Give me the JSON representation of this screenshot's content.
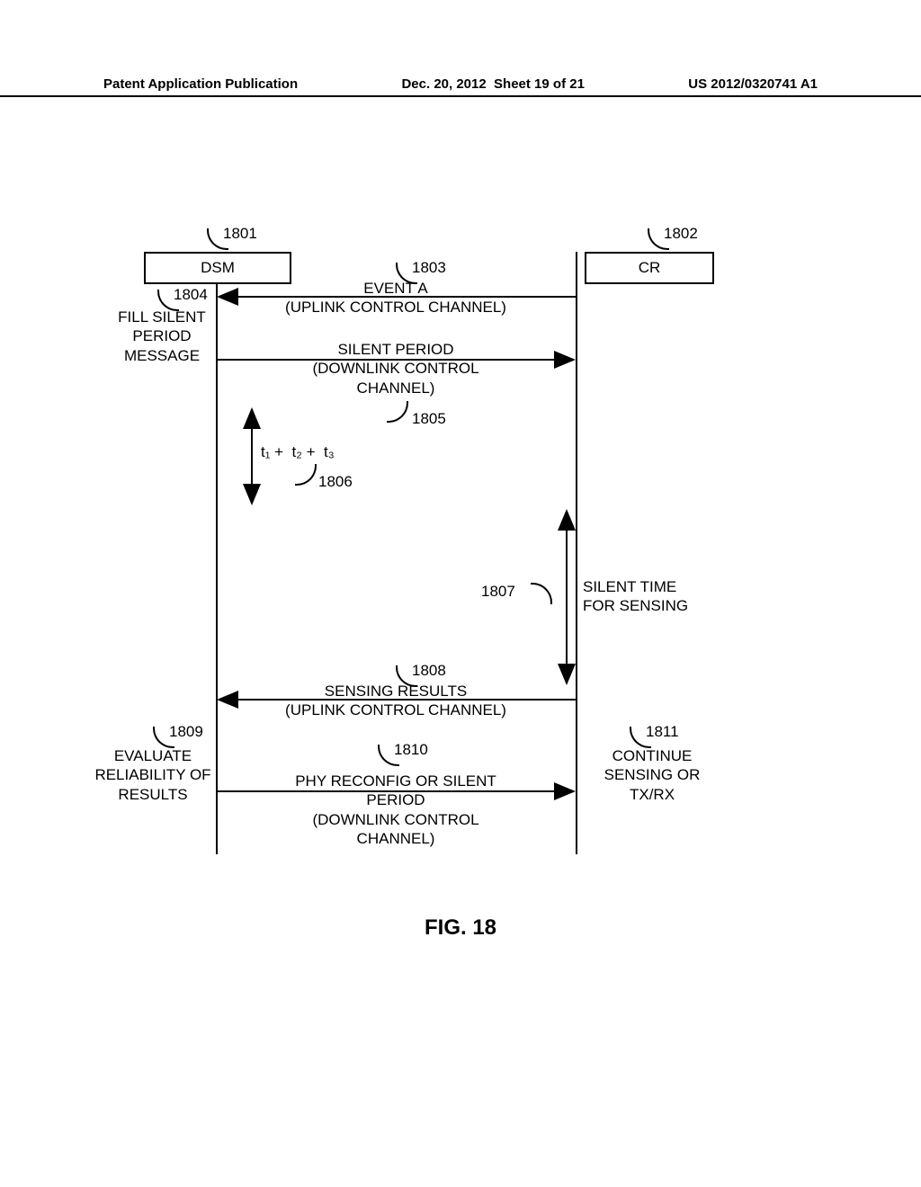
{
  "header": {
    "left": "Patent Application Publication",
    "center": "Dec. 20, 2012  Sheet 19 of 21",
    "right": "US 2012/0320741 A1"
  },
  "boxes": {
    "dsm": "DSM",
    "cr": "CR"
  },
  "refs": {
    "r1801": "1801",
    "r1802": "1802",
    "r1803": "1803",
    "r1804": "1804",
    "r1805": "1805",
    "r1806": "1806",
    "r1807": "1807",
    "r1808": "1808",
    "r1809": "1809",
    "r1810": "1810",
    "r1811": "1811"
  },
  "labels": {
    "event_a": "EVENT A\n(UPLINK CONTROL CHANNEL)",
    "fill_silent": "FILL SILENT\nPERIOD\nMESSAGE",
    "silent_period": "SILENT PERIOD\n(DOWNLINK CONTROL\nCHANNEL)",
    "time_formula": "t₁ +  t₂ +  t₃",
    "silent_time": "SILENT TIME\nFOR SENSING",
    "sensing_results": "SENSING RESULTS\n(UPLINK CONTROL CHANNEL)",
    "evaluate": "EVALUATE\nRELIABILITY OF\nRESULTS",
    "phy_reconfig": "PHY RECONFIG OR SILENT\nPERIOD\n(DOWNLINK CONTROL\nCHANNEL)",
    "continue": "CONTINUE\nSENSING OR\nTX/RX"
  },
  "figure": "FIG. 18"
}
